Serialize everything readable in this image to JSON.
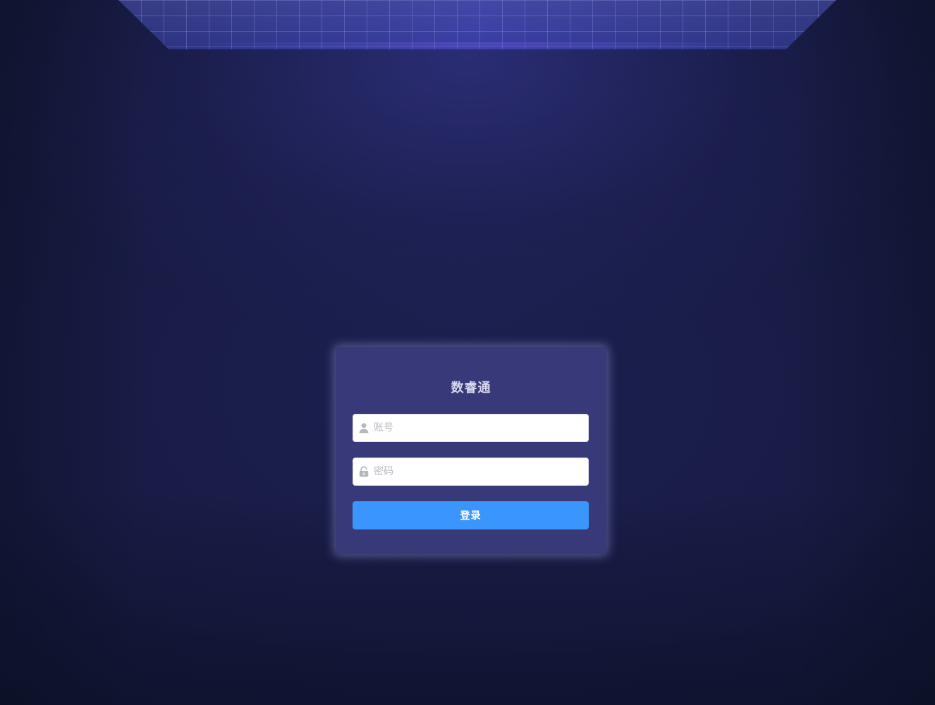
{
  "app": {
    "title": "数睿通"
  },
  "login_form": {
    "account_placeholder": "账号",
    "account_value": "",
    "password_placeholder": "密码",
    "password_value": "",
    "account_icon": "user-icon",
    "password_icon": "lock-icon",
    "submit_label": "登录"
  },
  "colors": {
    "card_background": "#383979",
    "button_background": "#3a96fd",
    "page_background": "#181c45"
  }
}
